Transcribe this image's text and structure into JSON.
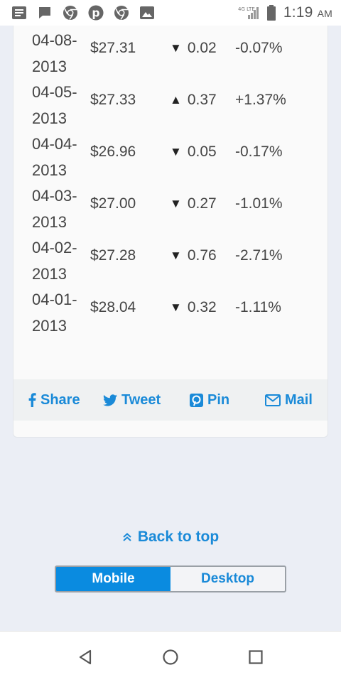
{
  "status_bar": {
    "icons": [
      "notes-icon",
      "chat-icon",
      "chrome-icon",
      "pinterest-icon",
      "chrome-icon",
      "image-icon"
    ],
    "network": "4G LTE",
    "time": "1:19",
    "ampm": "AM"
  },
  "prices": [
    {
      "date_line1": "04-08-",
      "date_line2": "2013",
      "price": "$27.31",
      "direction": "down",
      "arrow": "▼",
      "change": "0.02",
      "pct": "-0.07%"
    },
    {
      "date_line1": "04-05-",
      "date_line2": "2013",
      "price": "$27.33",
      "direction": "up",
      "arrow": "▲",
      "change": "0.37",
      "pct": "+1.37%"
    },
    {
      "date_line1": "04-04-",
      "date_line2": "2013",
      "price": "$26.96",
      "direction": "down",
      "arrow": "▼",
      "change": "0.05",
      "pct": "-0.17%"
    },
    {
      "date_line1": "04-03-",
      "date_line2": "2013",
      "price": "$27.00",
      "direction": "down",
      "arrow": "▼",
      "change": "0.27",
      "pct": "-1.01%"
    },
    {
      "date_line1": "04-02-",
      "date_line2": "2013",
      "price": "$27.28",
      "direction": "down",
      "arrow": "▼",
      "change": "0.76",
      "pct": "-2.71%"
    },
    {
      "date_line1": "04-01-",
      "date_line2": "2013",
      "price": "$28.04",
      "direction": "down",
      "arrow": "▼",
      "change": "0.32",
      "pct": "-1.11%"
    }
  ],
  "share": {
    "share_label": "Share",
    "tweet_label": "Tweet",
    "pin_label": "Pin",
    "mail_label": "Mail"
  },
  "footer": {
    "back_to_top": "Back to top",
    "mobile_label": "Mobile",
    "desktop_label": "Desktop"
  },
  "colors": {
    "link_blue": "#1a8ad8",
    "active_toggle": "#0a8be0",
    "page_bg": "#ebeef5"
  }
}
